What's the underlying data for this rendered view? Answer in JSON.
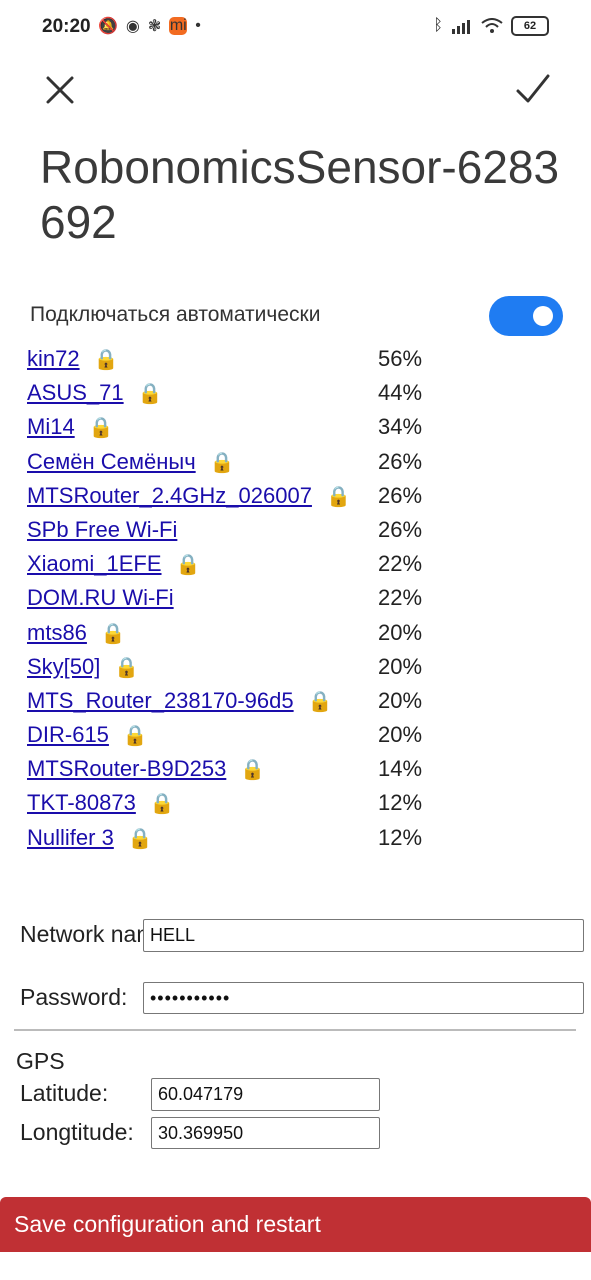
{
  "status": {
    "time": "20:20",
    "battery": "62",
    "icons": [
      "mute-icon",
      "wifi-icon",
      "flower-icon",
      "mi-icon",
      "dot-icon",
      "bluetooth-icon",
      "signal-icon",
      "wifi-icon",
      "battery-icon"
    ]
  },
  "dialog": {
    "title": "RobonomicsSensor-6283692",
    "auto_connect_label": "Подключаться автоматически",
    "auto_connect_on": true,
    "accent_color": "#1f7cf2"
  },
  "networks": [
    {
      "ssid": "kin72",
      "signal": "56%",
      "locked": true
    },
    {
      "ssid": "ASUS_71",
      "signal": "44%",
      "locked": true
    },
    {
      "ssid": "Mi14",
      "signal": "34%",
      "locked": true
    },
    {
      "ssid": "Семён Семёныч",
      "signal": "26%",
      "locked": true
    },
    {
      "ssid": "MTSRouter_2.4GHz_026007",
      "signal": "26%",
      "locked": true
    },
    {
      "ssid": "SPb Free Wi-Fi",
      "signal": "26%",
      "locked": false
    },
    {
      "ssid": "Xiaomi_1EFE",
      "signal": "22%",
      "locked": true
    },
    {
      "ssid": "DOM.RU Wi-Fi",
      "signal": "22%",
      "locked": false
    },
    {
      "ssid": "mts86",
      "signal": "20%",
      "locked": true
    },
    {
      "ssid": "Sky[50]",
      "signal": "20%",
      "locked": true
    },
    {
      "ssid": "MTS_Router_238170-96d5",
      "signal": "20%",
      "locked": true
    },
    {
      "ssid": "DIR-615",
      "signal": "20%",
      "locked": true
    },
    {
      "ssid": "MTSRouter-B9D253",
      "signal": "14%",
      "locked": true
    },
    {
      "ssid": "TKT-80873",
      "signal": "12%",
      "locked": true
    },
    {
      "ssid": "Nullifer 3",
      "signal": "12%",
      "locked": true
    }
  ],
  "form": {
    "network_name_label": "Network name:",
    "network_name_value": "HELL",
    "password_label": "Password:",
    "password_value": "•••••••••••",
    "gps_label": "GPS",
    "latitude_label": "Latitude:",
    "latitude_value": "60.047179",
    "longitude_label": "Longtitude:",
    "longitude_value": "30.369950"
  },
  "save_button": {
    "label": "Save configuration and restart",
    "color": "#c03034"
  }
}
